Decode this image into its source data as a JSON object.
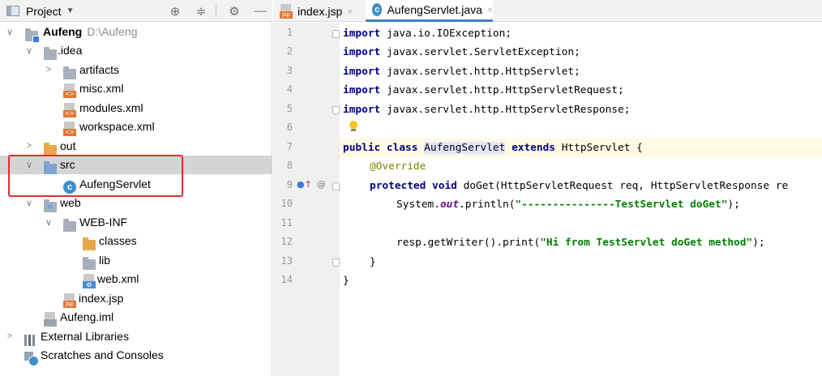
{
  "project_panel": {
    "title": "Project",
    "toolbar_icons": [
      "locate-icon",
      "collapse-icon",
      "settings-icon",
      "hide-icon"
    ]
  },
  "tree": {
    "root": {
      "name": "Aufeng",
      "path": "D:\\Aufeng"
    },
    "idea": "idea",
    "artifacts": "artifacts",
    "misc": "misc.xml",
    "modules": "modules.xml",
    "workspace": "workspace.xml",
    "out": "out",
    "src": "src",
    "servlet": "AufengServlet",
    "web": "web",
    "webinf": "WEB-INF",
    "classes": "classes",
    "lib": "lib",
    "webxml": "web.xml",
    "indexjsp": "index.jsp",
    "iml": "Aufeng.iml",
    "extlibs": "External Libraries",
    "scratches": "Scratches and Consoles"
  },
  "tabs": {
    "index": "index.jsp",
    "servlet": "AufengServlet.java"
  },
  "line_numbers": [
    "1",
    "2",
    "3",
    "4",
    "5",
    "6",
    "7",
    "8",
    "9",
    "10",
    "11",
    "12",
    "13",
    "14"
  ],
  "code": {
    "l1_kw": "import",
    "l1_rest": " java.io.IOException;",
    "l2_kw": "import",
    "l2_rest": " javax.servlet.ServletException;",
    "l3_kw": "import",
    "l3_rest": " javax.servlet.http.HttpServlet;",
    "l4_kw": "import",
    "l4_rest": " javax.servlet.http.HttpServletRequest;",
    "l5_kw": "import",
    "l5_rest": " javax.servlet.http.HttpServletResponse;",
    "l7_kw1": "public class",
    "l7_cls": "AufengServlet",
    "l7_kw2": "extends",
    "l7_rest": " HttpServlet {",
    "l8_ann": "@Override",
    "l9_kw": "protected void",
    "l9_rest": " doGet(HttpServletRequest req, HttpServletResponse re",
    "l10_a": "System.",
    "l10_fld": "out",
    "l10_b": ".println(",
    "l10_str": "\"---------------TestServlet doGet\"",
    "l10_c": ");",
    "l12_a": "resp.getWriter().print(",
    "l12_str": "\"Hi from TestServlet doGet method\"",
    "l12_c": ");",
    "l13": "}",
    "l14": "}"
  }
}
